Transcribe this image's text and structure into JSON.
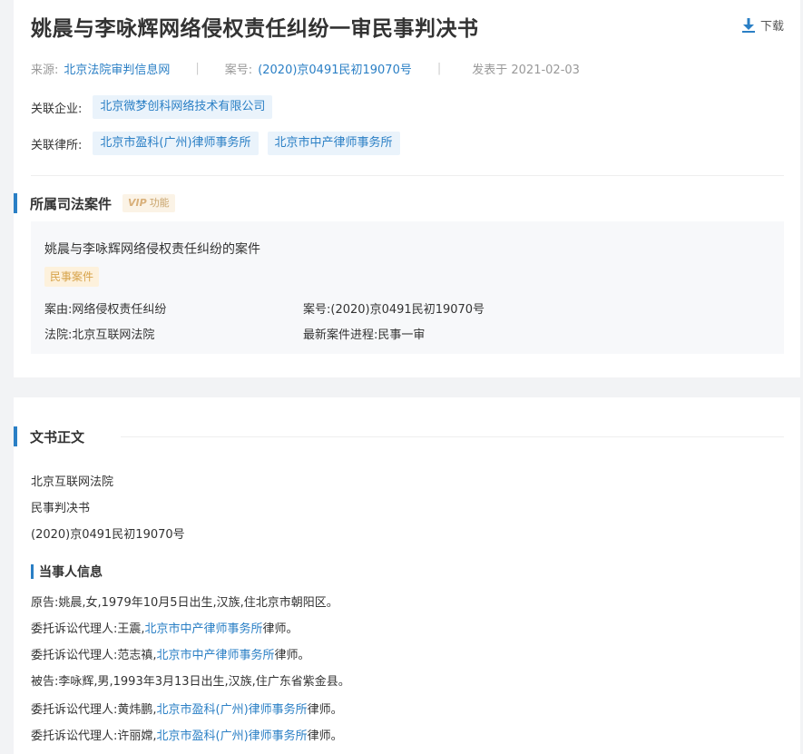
{
  "header": {
    "title": "姚晨与李咏辉网络侵权责任纠纷一审民事判决书",
    "download_label": "下载"
  },
  "meta": {
    "source_label": "来源:",
    "source_value": "北京法院审判信息网",
    "case_no_label": "案号:",
    "case_no_value": "(2020)京0491民初19070号",
    "published": "发表于 2021-02-03"
  },
  "related": {
    "company_label": "关联企业:",
    "companies": [
      "北京微梦创科网络技术有限公司"
    ],
    "lawfirm_label": "关联律所:",
    "lawfirms": [
      "北京市盈科(广州)律师事务所",
      "北京市中产律师事务所"
    ]
  },
  "judicial": {
    "section_title": "所属司法案件",
    "vip_mark": "VIP",
    "vip_label": "功能",
    "case_title": "姚晨与李咏辉网络侵权责任纠纷的案件",
    "case_type": "民事案件",
    "cause": "案由:网络侵权责任纠纷",
    "case_no": "案号:(2020)京0491民初19070号",
    "court": "法院:北京互联网法院",
    "progress": "最新案件进程:民事一审"
  },
  "document": {
    "section_title": "文书正文",
    "court": "北京互联网法院",
    "doc_type": "民事判决书",
    "case_no": "(2020)京0491民初19070号",
    "party_section_title": "当事人信息",
    "parties": [
      {
        "prefix": "原告:姚晨,女,1979年10月5日出生,汉族,住北京市朝阳区。",
        "link": "",
        "suffix": ""
      },
      {
        "prefix": "委托诉讼代理人:王震,",
        "link": "北京市中产律师事务所",
        "suffix": "律师。"
      },
      {
        "prefix": "委托诉讼代理人:范志禛,",
        "link": "北京市中产律师事务所",
        "suffix": "律师。"
      },
      {
        "prefix": "被告:李咏辉,男,1993年3月13日出生,汉族,住广东省紫金县。",
        "link": "",
        "suffix": ""
      },
      {
        "prefix": "委托诉讼代理人:黄炜鹏,",
        "link": "北京市盈科(广州)律师事务所",
        "suffix": "律师。"
      },
      {
        "prefix": "委托诉讼代理人:许丽嫦,",
        "link": "北京市盈科(广州)律师事务所",
        "suffix": "律师。"
      }
    ]
  },
  "colors": {
    "accent": "#2a7fc5",
    "tag_bg": "#eaf3fb",
    "case_type_bg": "#fdf1dc",
    "case_type_text": "#d7a34a"
  },
  "icons": {
    "download": "download-icon"
  }
}
